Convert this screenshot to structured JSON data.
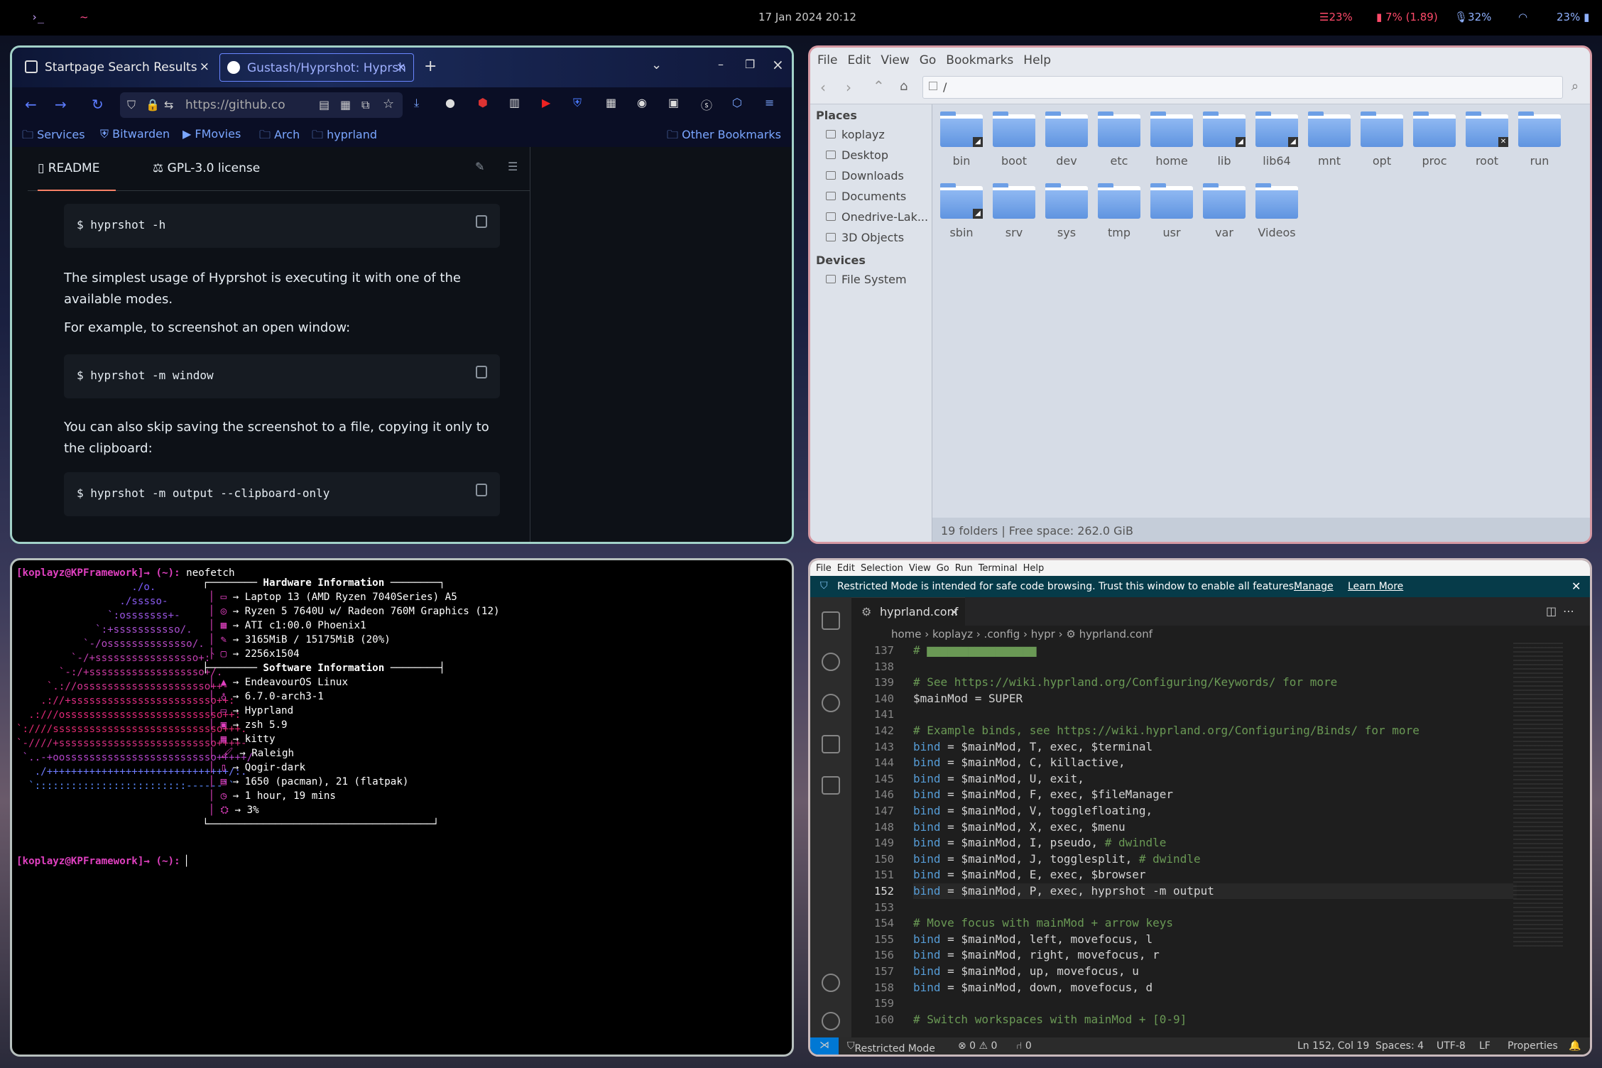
{
  "topbar": {
    "terminal_icon": "›_",
    "tilde": "~",
    "datetime": "17 Jan 2024 20:12",
    "mem": "23%",
    "cpu": "7% (1.89)",
    "mic": "32%",
    "battery": "23%",
    "colors": {
      "mem": "#ff4a6a",
      "cpu": "#ff4a6a",
      "mic": "#8fb1ff",
      "wifi": "#8fb1ff",
      "battery": "#8fb1ff"
    }
  },
  "browser": {
    "tabs": [
      {
        "title": "Startpage Search Results",
        "close": "×"
      },
      {
        "title": "Gustash/Hyprshot: Hyprsh",
        "close": "×"
      }
    ],
    "new_tab": "+",
    "url": "https://github.co",
    "bookmarks": [
      "Services",
      "Bitwarden",
      "FMovies",
      "Arch",
      "hyprland"
    ],
    "other_bookmarks": "Other Bookmarks",
    "readme_tab": "README",
    "license_tab": "GPL-3.0 license",
    "blocks": [
      "$ hyprshot -h",
      "$ hyprshot -m window",
      "$ hyprshot -m output --clipboard-only"
    ],
    "paras": [
      "The simplest usage of Hyprshot is executing it with one of the available modes.",
      "For example, to screenshot an open window:",
      "You can also skip saving the screenshot to a file, copying it only to the clipboard:"
    ]
  },
  "files": {
    "menu": [
      "File",
      "Edit",
      "View",
      "Go",
      "Bookmarks",
      "Help"
    ],
    "path": "/",
    "places_header": "Places",
    "places": [
      "koplayz",
      "Desktop",
      "Downloads",
      "Documents",
      "Onedrive-Lak...",
      "3D Objects"
    ],
    "devices_header": "Devices",
    "devices": [
      "File System"
    ],
    "folders": [
      "bin",
      "boot",
      "dev",
      "etc",
      "home",
      "lib",
      "lib64",
      "mnt",
      "opt",
      "proc",
      "root",
      "run",
      "sbin",
      "srv",
      "sys",
      "tmp",
      "usr",
      "var",
      "Videos"
    ],
    "status": "19 folders  |  Free space: 262.0 GiB"
  },
  "terminal": {
    "prompt": "[koplayz@KPFramework]→ (~): ",
    "cmd": "neofetch",
    "hw_header": "Hardware Information",
    "sw_header": "Software Information",
    "hw": [
      "Laptop 13 (AMD Ryzen 7040Series) A5",
      "Ryzen 5 7640U w/ Radeon 760M Graphics (12)",
      "ATI c1:00.0 Phoenix1",
      "3165MiB / 15175MiB (20%)",
      "2256x1504"
    ],
    "sw": [
      "EndeavourOS Linux",
      "6.7.0-arch3-1",
      "Hyprland",
      "zsh 5.9",
      "kitty",
      "Raleigh",
      "Qogir-dark",
      "1650 (pacman), 21 (flatpak)",
      "1 hour, 19 mins",
      "3%"
    ],
    "logo": [
      "                   ./o.",
      "                 ./sssso-",
      "               `:osssssss+-",
      "             `:+sssssssssso/.",
      "           `-/ossssssssssssso/.",
      "         `-/+sssssssssssssssso+:`",
      "       `-:/+sssssssssssssssssso+/.",
      "     `.://osssssssssssssssssssso++-",
      "    .://+ssssssssssssssssssssssso++:",
      "  .:///ossssssssssssssssssssssssso++:",
      "`:////ssssssssssssssssssssssssssso+++.",
      "`-////+ssssssssssssssssssssssssso++++-",
      " `..-+oosssssssssssssssssssssssso+++++/`",
      "   ./++++++++++++++++++++++++++++++/:.",
      "  `:::::::::::::::::::::::::------``"
    ]
  },
  "code": {
    "menu": [
      "File",
      "Edit",
      "Selection",
      "View",
      "Go",
      "Run",
      "Terminal",
      "Help"
    ],
    "banner": "Restricted Mode is intended for safe code browsing. Trust this window to enable all features.",
    "manage": "Manage",
    "learn": "Learn More",
    "tab": "hyprland.conf",
    "crumbs": "home  ›  koplayz  ›  .config  ›  hypr  ›  ⚙ hyprland.conf",
    "lines": [
      {
        "n": "137",
        "t": "# ▆▆▆▆▆▆▆▆▆▆▆▆▆▆▆▆",
        "c": "cm"
      },
      {
        "n": "138",
        "t": ""
      },
      {
        "n": "139",
        "t": "# See https://wiki.hyprland.org/Configuring/Keywords/ for more",
        "c": "cm"
      },
      {
        "n": "140",
        "t": "$mainMod = SUPER"
      },
      {
        "n": "141",
        "t": ""
      },
      {
        "n": "142",
        "t": "# Example binds, see https://wiki.hyprland.org/Configuring/Binds/ for more",
        "c": "cm"
      },
      {
        "n": "143",
        "k": "bind",
        "t": " = $mainMod, T, exec, $terminal"
      },
      {
        "n": "144",
        "k": "bind",
        "t": " = $mainMod, C, killactive,"
      },
      {
        "n": "145",
        "k": "bind",
        "t": " = $mainMod, U, exit,"
      },
      {
        "n": "146",
        "k": "bind",
        "t": " = $mainMod, F, exec, $fileManager"
      },
      {
        "n": "147",
        "k": "bind",
        "t": " = $mainMod, V, togglefloating,"
      },
      {
        "n": "148",
        "k": "bind",
        "t": " = $mainMod, X, exec, $menu"
      },
      {
        "n": "149",
        "k": "bind",
        "t": " = $mainMod, I, pseudo, ",
        "cm": "# dwindle"
      },
      {
        "n": "150",
        "k": "bind",
        "t": " = $mainMod, J, togglesplit, ",
        "cm": "# dwindle"
      },
      {
        "n": "151",
        "k": "bind",
        "t": " = $mainMod, E, exec, $browser"
      },
      {
        "n": "152",
        "k": "bind",
        "t": " = $mainMod, P, exec, hyprshot -m output"
      },
      {
        "n": "153",
        "t": ""
      },
      {
        "n": "154",
        "t": "# Move focus with mainMod + arrow keys",
        "c": "cm"
      },
      {
        "n": "155",
        "k": "bind",
        "t": " = $mainMod, left, movefocus, l"
      },
      {
        "n": "156",
        "k": "bind",
        "t": " = $mainMod, right, movefocus, r"
      },
      {
        "n": "157",
        "k": "bind",
        "t": " = $mainMod, up, movefocus, u"
      },
      {
        "n": "158",
        "k": "bind",
        "t": " = $mainMod, down, movefocus, d"
      },
      {
        "n": "159",
        "t": ""
      },
      {
        "n": "160",
        "t": "# Switch workspaces with mainMod + [0-9]",
        "c": "cm"
      }
    ],
    "status": {
      "mode": "Restricted Mode",
      "errors": "⊗ 0 ⚠ 0",
      "ports": "⑁ 0",
      "pos": "Ln 152, Col 19",
      "spaces": "Spaces: 4",
      "enc": "UTF-8",
      "eol": "LF",
      "props": "Properties"
    }
  }
}
